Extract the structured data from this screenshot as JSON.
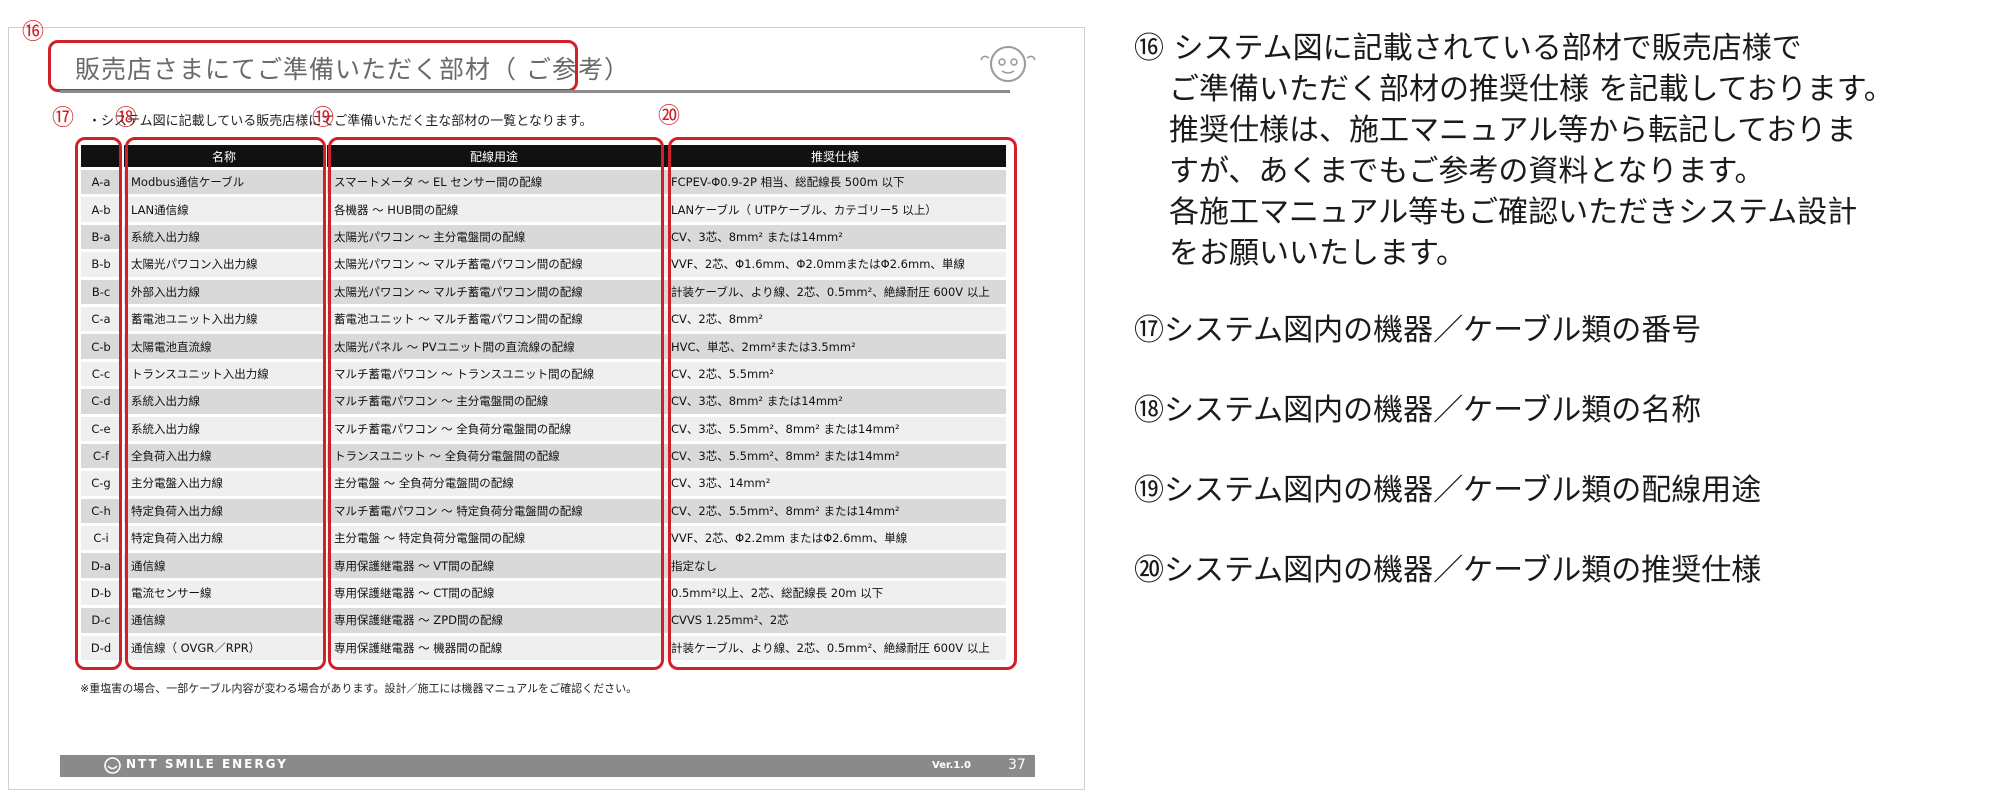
{
  "slide": {
    "title": "販売店さまにてご準備いただく部材（ ご参考）",
    "intro": "・システム図に記載している販売店様にてご準備いただく主な部材の一覧となります。",
    "markers": {
      "m16": "⑯",
      "m17": "⑰",
      "m18": "⑱",
      "m19": "⑲",
      "m20": "⑳"
    },
    "headers": {
      "code": "",
      "name": "名称",
      "use": "配線用途",
      "spec": "推奨仕様"
    },
    "rows": [
      {
        "code": "A-a",
        "name": "Modbus通信ケーブル",
        "use": "スマートメータ ～ EL センサー間の配線",
        "spec": "FCPEV-Φ0.9-2P 相当、総配線長 500m 以下"
      },
      {
        "code": "A-b",
        "name": "LAN通信線",
        "use": "各機器 ～ HUB間の配線",
        "spec": "LANケーブル（ UTPケーブル、カテゴリー5 以上）"
      },
      {
        "code": "B-a",
        "name": "系統入出力線",
        "use": "太陽光パワコン ～ 主分電盤間の配線",
        "spec": "CV、3芯、8mm² または14mm²"
      },
      {
        "code": "B-b",
        "name": "太陽光パワコン入出力線",
        "use": "太陽光パワコン ～ マルチ蓄電パワコン間の配線",
        "spec": "VVF、2芯、Φ1.6mm、Φ2.0mmまたはΦ2.6mm、単線"
      },
      {
        "code": "B-c",
        "name": "外部入出力線",
        "use": "太陽光パワコン ～ マルチ蓄電パワコン間の配線",
        "spec": "計装ケーブル、より線、2芯、0.5mm²、絶縁耐圧 600V 以上"
      },
      {
        "code": "C-a",
        "name": "蓄電池ユニット入出力線",
        "use": "蓄電池ユニット ～ マルチ蓄電パワコン間の配線",
        "spec": "CV、2芯、8mm²"
      },
      {
        "code": "C-b",
        "name": "太陽電池直流線",
        "use": "太陽光パネル ～ PVユニット間の直流線の配線",
        "spec": "HVC、単芯、2mm²または3.5mm²"
      },
      {
        "code": "C-c",
        "name": "トランスユニット入出力線",
        "use": "マルチ蓄電パワコン ～ トランスユニット間の配線",
        "spec": "CV、2芯、5.5mm²"
      },
      {
        "code": "C-d",
        "name": "系統入出力線",
        "use": "マルチ蓄電パワコン ～ 主分電盤間の配線",
        "spec": "CV、3芯、8mm² または14mm²"
      },
      {
        "code": "C-e",
        "name": "系統入出力線",
        "use": "マルチ蓄電パワコン ～ 全負荷分電盤間の配線",
        "spec": "CV、3芯、5.5mm²、8mm² または14mm²"
      },
      {
        "code": "C-f",
        "name": "全負荷入出力線",
        "use": "トランスユニット ～ 全負荷分電盤間の配線",
        "spec": "CV、3芯、5.5mm²、8mm² または14mm²"
      },
      {
        "code": "C-g",
        "name": "主分電盤入出力線",
        "use": "主分電盤 ～ 全負荷分電盤間の配線",
        "spec": "CV、3芯、14mm²"
      },
      {
        "code": "C-h",
        "name": "特定負荷入出力線",
        "use": "マルチ蓄電パワコン ～ 特定負荷分電盤間の配線",
        "spec": "CV、2芯、5.5mm²、8mm² または14mm²"
      },
      {
        "code": "C-i",
        "name": "特定負荷入出力線",
        "use": "主分電盤 ～ 特定負荷分電盤間の配線",
        "spec": "VVF、2芯、Φ2.2mm またはΦ2.6mm、単線"
      },
      {
        "code": "D-a",
        "name": "通信線",
        "use": "専用保護継電器 ～ VT間の配線",
        "spec": "指定なし"
      },
      {
        "code": "D-b",
        "name": "電流センサー線",
        "use": "専用保護継電器 ～ CT間の配線",
        "spec": "0.5mm²以上、2芯、総配線長 20m 以下"
      },
      {
        "code": "D-c",
        "name": "通信線",
        "use": "専用保護継電器 ～ ZPD間の配線",
        "spec": "CVVS 1.25mm²、2芯"
      },
      {
        "code": "D-d",
        "name": "通信線（ OVGR／RPR）",
        "use": "専用保護継電器 ～ 機器間の配線",
        "spec": "計装ケーブル、より線、2芯、0.5mm²、絶縁耐圧 600V 以上"
      }
    ],
    "note": "※重塩害の場合、一部ケーブル内容が変わる場合があります。設計／施工には機器マニュアルをご確認ください。",
    "footer": {
      "logo": "NTT SMILE ENERGY",
      "version": "Ver.1.0",
      "page": "37"
    }
  },
  "explanations": {
    "e16_lines": [
      "⑯ システム図に記載されている部材で販売店様で",
      "ご準備いただく部材の推奨仕様 を記載しております。",
      "推奨仕様は、施工マニュアル等から転記しておりま",
      "すが、あくまでもご参考の資料となります。",
      "各施工マニュアル等もご確認いただきシステム設計",
      "をお願いいたします。"
    ],
    "e17": "⑰システム図内の機器／ケーブル類の番号",
    "e18": "⑱システム図内の機器／ケーブル類の名称",
    "e19": "⑲システム図内の機器／ケーブル類の配線用途",
    "e20": "⑳システム図内の機器／ケーブル類の推奨仕様"
  },
  "colors": {
    "accent_red": "#d0202a",
    "header_black": "#111111",
    "footer_gray": "#8a8a8a"
  }
}
